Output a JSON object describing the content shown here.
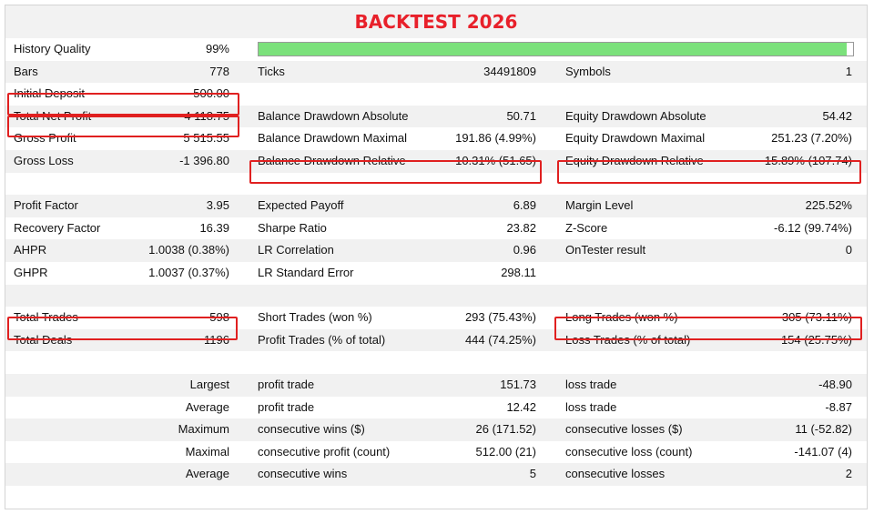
{
  "title": "BACKTEST 2026",
  "history_quality": {
    "label": "History Quality",
    "value": "99%",
    "fraction": 0.99,
    "bar_color": "#7be17b"
  },
  "highlight_color": "#e02020",
  "bars": {
    "label": "Bars",
    "value": "778"
  },
  "ticks": {
    "label": "Ticks",
    "value": "34491809"
  },
  "symbols": {
    "label": "Symbols",
    "value": "1"
  },
  "initial_deposit": {
    "label": "Initial Deposit",
    "value": "500.00"
  },
  "total_net_profit": {
    "label": "Total Net Profit",
    "value": "4 118.75"
  },
  "balance_dd_absolute": {
    "label": "Balance Drawdown Absolute",
    "value": "50.71"
  },
  "equity_dd_absolute": {
    "label": "Equity Drawdown Absolute",
    "value": "54.42"
  },
  "gross_profit": {
    "label": "Gross Profit",
    "value": "5 515.55"
  },
  "balance_dd_maximal": {
    "label": "Balance Drawdown Maximal",
    "value": "191.86 (4.99%)"
  },
  "equity_dd_maximal": {
    "label": "Equity Drawdown Maximal",
    "value": "251.23 (7.20%)"
  },
  "gross_loss": {
    "label": "Gross Loss",
    "value": "-1 396.80"
  },
  "balance_dd_relative": {
    "label": "Balance Drawdown Relative",
    "value": "10.31% (51.65)"
  },
  "equity_dd_relative": {
    "label": "Equity Drawdown Relative",
    "value": "15.89% (107.74)"
  },
  "profit_factor": {
    "label": "Profit Factor",
    "value": "3.95"
  },
  "expected_payoff": {
    "label": "Expected Payoff",
    "value": "6.89"
  },
  "margin_level": {
    "label": "Margin Level",
    "value": "225.52%"
  },
  "recovery_factor": {
    "label": "Recovery Factor",
    "value": "16.39"
  },
  "sharpe_ratio": {
    "label": "Sharpe Ratio",
    "value": "23.82"
  },
  "z_score": {
    "label": "Z-Score",
    "value": "-6.12 (99.74%)"
  },
  "ahpr": {
    "label": "AHPR",
    "value": "1.0038 (0.38%)"
  },
  "lr_correlation": {
    "label": "LR Correlation",
    "value": "0.96"
  },
  "ontester": {
    "label": "OnTester result",
    "value": "0"
  },
  "ghpr": {
    "label": "GHPR",
    "value": "1.0037 (0.37%)"
  },
  "lr_std_error": {
    "label": "LR Standard Error",
    "value": "298.11"
  },
  "total_trades": {
    "label": "Total Trades",
    "value": "598"
  },
  "short_trades": {
    "label": "Short Trades (won %)",
    "value": "293 (75.43%)"
  },
  "long_trades": {
    "label": "Long Trades (won %)",
    "value": "305 (73.11%)"
  },
  "total_deals": {
    "label": "Total Deals",
    "value": "1196"
  },
  "profit_trades": {
    "label": "Profit Trades (% of total)",
    "value": "444 (74.25%)"
  },
  "loss_trades": {
    "label": "Loss Trades (% of total)",
    "value": "154 (25.75%)"
  },
  "largest": {
    "prefix": "Largest",
    "profit_label": "profit trade",
    "profit_value": "151.73",
    "loss_label": "loss trade",
    "loss_value": "-48.90"
  },
  "average": {
    "prefix": "Average",
    "profit_label": "profit trade",
    "profit_value": "12.42",
    "loss_label": "loss trade",
    "loss_value": "-8.87"
  },
  "maximum": {
    "prefix": "Maximum",
    "profit_label": "consecutive wins ($)",
    "profit_value": "26 (171.52)",
    "loss_label": "consecutive losses ($)",
    "loss_value": "11 (-52.82)"
  },
  "maximal": {
    "prefix": "Maximal",
    "profit_label": "consecutive profit (count)",
    "profit_value": "512.00 (21)",
    "loss_label": "consecutive loss (count)",
    "loss_value": "-141.07 (4)"
  },
  "average_consec": {
    "prefix": "Average",
    "profit_label": "consecutive wins",
    "profit_value": "5",
    "loss_label": "consecutive losses",
    "loss_value": "2"
  }
}
